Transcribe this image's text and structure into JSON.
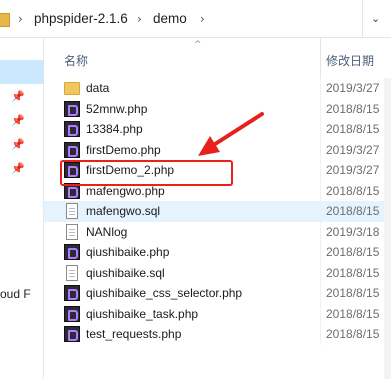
{
  "breadcrumb": {
    "items": [
      "phpspider-2.1.6",
      "demo"
    ],
    "separator": "›",
    "dropdown": "⌄"
  },
  "nav": {
    "pins": [
      "pin-icon",
      "pin-icon",
      "pin-icon",
      "pin-icon"
    ],
    "truncated_label": "oud F"
  },
  "columns": {
    "name": "名称",
    "date": "修改日期",
    "sort_indicator": "^"
  },
  "files": [
    {
      "name": "data",
      "date": "2019/3/27",
      "type": "folder"
    },
    {
      "name": "52mnw.php",
      "date": "2018/8/15",
      "type": "php"
    },
    {
      "name": "13384.php",
      "date": "2018/8/15",
      "type": "php"
    },
    {
      "name": "firstDemo.php",
      "date": "2019/3/27",
      "type": "php"
    },
    {
      "name": "firstDemo_2.php",
      "date": "2019/3/27",
      "type": "php"
    },
    {
      "name": "mafengwo.php",
      "date": "2018/8/15",
      "type": "php"
    },
    {
      "name": "mafengwo.sql",
      "date": "2018/8/15",
      "type": "doc"
    },
    {
      "name": "NANlog",
      "date": "2019/3/18",
      "type": "doc"
    },
    {
      "name": "qiushibaike.php",
      "date": "2018/8/15",
      "type": "php"
    },
    {
      "name": "qiushibaike.sql",
      "date": "2018/8/15",
      "type": "doc"
    },
    {
      "name": "qiushibaike_css_selector.php",
      "date": "2018/8/15",
      "type": "php"
    },
    {
      "name": "qiushibaike_task.php",
      "date": "2018/8/15",
      "type": "php"
    },
    {
      "name": "test_requests.php",
      "date": "2018/8/15",
      "type": "php"
    }
  ],
  "colors": {
    "annotation": "#e8211c",
    "hover_row": "#e5f3ff",
    "nav_selected": "#cce8ff"
  }
}
